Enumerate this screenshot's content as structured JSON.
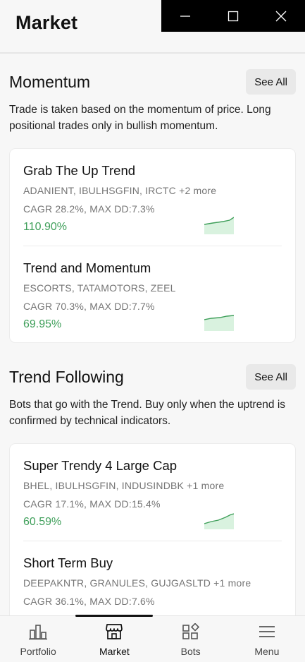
{
  "header": {
    "title": "Market"
  },
  "window_controls": {
    "minimize": "minimize",
    "maximize": "maximize",
    "close": "close"
  },
  "sections": [
    {
      "title": "Momentum",
      "see_all_label": "See All",
      "description": "Trade is taken based on the momentum of price. Long positional trades only in bullish momentum.",
      "bots": [
        {
          "name": "Grab The Up Trend",
          "symbols": "ADANIENT, IBULHSGFIN, IRCTC +2 more",
          "stats": "CAGR 28.2%, MAX DD:7.3%",
          "return": "110.90%"
        },
        {
          "name": "Trend and Momentum",
          "symbols": "ESCORTS, TATAMOTORS, ZEEL",
          "stats": "CAGR 70.3%, MAX DD:7.7%",
          "return": "69.95%"
        }
      ]
    },
    {
      "title": "Trend Following",
      "see_all_label": "See All",
      "description": "Bots that go with the Trend. Buy only when the uptrend is confirmed by technical indicators.",
      "bots": [
        {
          "name": "Super Trendy 4 Large Cap",
          "symbols": "BHEL, IBULHSGFIN, INDUSINDBK +1 more",
          "stats": "CAGR 17.1%, MAX DD:15.4%",
          "return": "60.59%"
        },
        {
          "name": "Short Term Buy",
          "symbols": "DEEPAKNTR, GRANULES, GUJGASLTD +1 more",
          "stats": "CAGR 36.1%, MAX DD:7.6%",
          "return": ""
        }
      ]
    }
  ],
  "bottom_nav": [
    {
      "label": "Portfolio",
      "icon": "bar-chart-icon"
    },
    {
      "label": "Market",
      "icon": "store-icon",
      "active": true
    },
    {
      "label": "Bots",
      "icon": "grid-icon"
    },
    {
      "label": "Menu",
      "icon": "hamburger-icon"
    }
  ],
  "colors": {
    "accent_green": "#3f9f5a",
    "spark_fill": "#d9f2df",
    "background": "#f7f7f7"
  }
}
